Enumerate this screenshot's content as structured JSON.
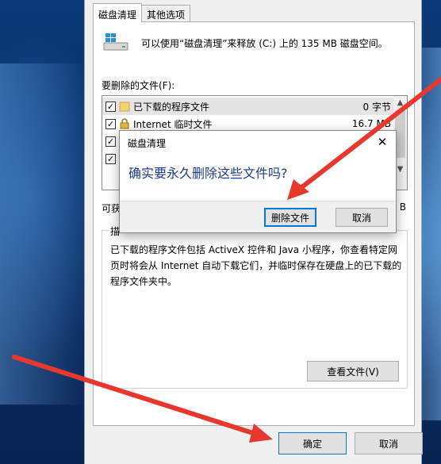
{
  "tabs": [
    {
      "label": "磁盘清理",
      "active": true
    },
    {
      "label": "其他选项",
      "active": false
    }
  ],
  "summary_text": "可以使用“磁盘清理”来释放  (C:) 上的 135 MB 磁盘空间。",
  "files_label": "要删除的文件(F):",
  "files": [
    {
      "name": "已下载的程序文件",
      "size": "0 字节",
      "checked": true,
      "selected": true,
      "icon": "folder-icon"
    },
    {
      "name": "Internet 临时文件",
      "size": "16.7 MB",
      "checked": true,
      "selected": false,
      "icon": "lock-icon"
    },
    {
      "name": "",
      "size": "",
      "checked": true,
      "selected": false,
      "icon": ""
    },
    {
      "name": "",
      "size": "",
      "checked": true,
      "selected": false,
      "icon": ""
    }
  ],
  "gain_label": "可获",
  "gain_value": "B",
  "description": {
    "legend": "描",
    "text": "已下载的程序文件包括 ActiveX 控件和 Java 小程序，你查看特定网页时将会从 Internet 自动下载它们，并临时保存在硬盘上的已下载的程序文件夹中。"
  },
  "view_files_button": "查看文件(V)",
  "ok_button": "确定",
  "cancel_button": "取消",
  "dialog": {
    "title": "磁盘清理",
    "message": "确实要永久删除这些文件吗?",
    "confirm_button": "删除文件",
    "cancel_button": "取消",
    "close_glyph": "✕"
  },
  "colors": {
    "arrow": "#e8382e",
    "dialog_message": "#1e3a8a",
    "focus_border": "#0078d7"
  }
}
